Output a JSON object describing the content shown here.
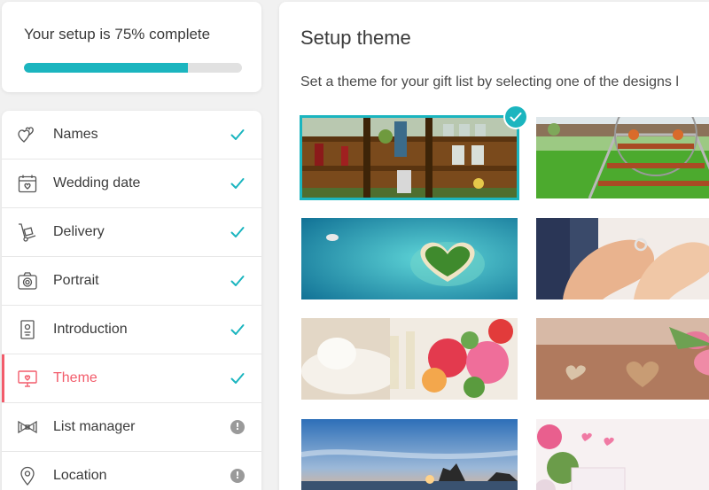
{
  "progress": {
    "title": "Your setup is 75% complete",
    "percent": 75,
    "bar_color": "#1bb5bf"
  },
  "steps": [
    {
      "label": "Names",
      "icon": "hearts-icon",
      "status": "complete"
    },
    {
      "label": "Wedding date",
      "icon": "calendar-icon",
      "status": "complete"
    },
    {
      "label": "Delivery",
      "icon": "hand-truck-icon",
      "status": "complete"
    },
    {
      "label": "Portrait",
      "icon": "camera-icon",
      "status": "complete"
    },
    {
      "label": "Introduction",
      "icon": "card-icon",
      "status": "complete"
    },
    {
      "label": "Theme",
      "icon": "monitor-icon",
      "status": "complete",
      "active": true
    },
    {
      "label": "List manager",
      "icon": "gift-bow-icon",
      "status": "info",
      "status_glyph": "!"
    },
    {
      "label": "Location",
      "icon": "location-pin-icon",
      "status": "info",
      "status_glyph": "!"
    }
  ],
  "colors": {
    "accent": "#1bb5bf",
    "active": "#f25c6b",
    "check": "#1bb5bf"
  },
  "main": {
    "title": "Setup theme",
    "description": "Set a theme for your gift list by selecting one of the designs l"
  },
  "themes": [
    {
      "name": "bar-shelves-theme",
      "selected": true
    },
    {
      "name": "garden-cake-stand-theme",
      "selected": false
    },
    {
      "name": "heart-island-theme",
      "selected": false
    },
    {
      "name": "wedding-rings-hands-theme",
      "selected": false
    },
    {
      "name": "champagne-flowers-theme",
      "selected": false
    },
    {
      "name": "tulips-wooden-hearts-theme",
      "selected": false
    },
    {
      "name": "sunset-sea-theme",
      "selected": false
    },
    {
      "name": "pink-flowers-gift-theme",
      "selected": false
    }
  ]
}
